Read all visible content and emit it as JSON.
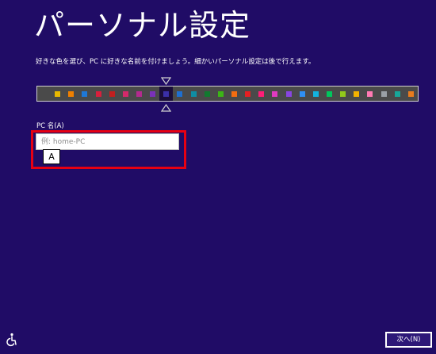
{
  "title": "パーソナル設定",
  "description": "好きな色を選び、PC に好きな名前を付けましょう。細かいパーソナル設定は後で行えます。",
  "color_picker": {
    "selected_index": 9,
    "swatches": [
      "#4a4a4a",
      "#e8b800",
      "#f08000",
      "#1e78d6",
      "#d81f3c",
      "#c21f1f",
      "#d4296b",
      "#b32a8e",
      "#7a31b8",
      "#3a2fa8",
      "#1e6fd0",
      "#0f8da3",
      "#117a2f",
      "#3cb516",
      "#f36d10",
      "#e51f22",
      "#ff1d77",
      "#e03ac0",
      "#8845e0",
      "#2f8ff3",
      "#12b3de",
      "#00c75c",
      "#92c91a",
      "#f2b200",
      "#ff7ab3",
      "#9aa0a6",
      "#17a79a",
      "#e87c1e"
    ]
  },
  "pc_name": {
    "label": "PC 名(A)",
    "value": "",
    "placeholder": "例: home-PC",
    "ime_mode": "A"
  },
  "next_button_label": "次へ(N)",
  "colors": {
    "background": "#200c66",
    "highlight": "#e60012"
  }
}
